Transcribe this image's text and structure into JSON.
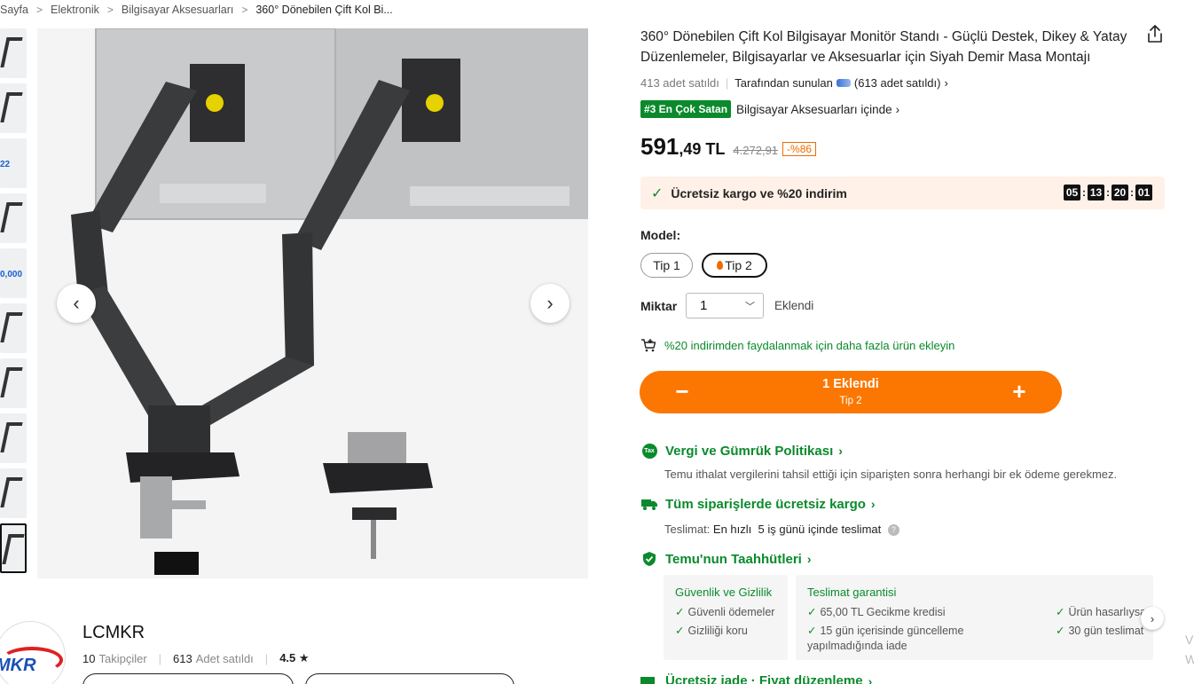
{
  "breadcrumb": {
    "items": [
      "Sayfa",
      "Elektronik",
      "Bilgisayar Aksesuarları",
      "360° Dönebilen Çift Kol Bi..."
    ],
    "separator": ">"
  },
  "gallery": {
    "prev_label": "‹",
    "next_label": "›",
    "thumb_badges": [
      "22",
      "0,000"
    ]
  },
  "seller": {
    "logo_text": "MKR",
    "name": "LCMKR",
    "followers_value": "10",
    "followers_label": "Takipçiler",
    "sold_value": "613",
    "sold_label": "Adet satıldı",
    "rating": "4.5 ★"
  },
  "product": {
    "title": "360° Dönebilen Çift Kol Bilgisayar Monitör Standı - Güçlü Destek, Dikey & Yatay Düzenlemeler, Bilgisayarlar ve Aksesuarlar için Siyah Demir Masa Montajı",
    "sold_count": "413 adet satıldı",
    "offered_by": "Tarafından sunulan",
    "offered_sold": "(613 adet satıldı)",
    "bestseller_tag": "#3 En Çok Satan",
    "bestseller_category": "Bilgisayar Aksesuarları içinde",
    "price_int": "591",
    "price_dec": ",49",
    "currency": "TL",
    "old_price": "4.272,91",
    "discount": "-%86"
  },
  "promo": {
    "text": "Ücretsiz kargo ve %20 indirim",
    "timer": [
      "05",
      "13",
      "20",
      "01"
    ]
  },
  "options": {
    "model_label": "Model:",
    "models": [
      "Tip 1",
      "Tip 2"
    ],
    "selected_model": "Tip 2",
    "qty_label": "Miktar",
    "qty_value": "1",
    "qty_added": "Eklendi"
  },
  "cart_hint": "%20 indirimden faydalanmak için daha fazla ürün ekleyin",
  "add_bar": {
    "minus": "−",
    "plus": "+",
    "main_label": "1 Eklendi",
    "sub_label": "Tip 2"
  },
  "policies": {
    "tax_icon_text": "Tax",
    "tax_title": "Vergi ve Gümrük Politikası",
    "tax_text": "Temu ithalat vergilerini tahsil ettiği için siparişten sonra herhangi bir ek ödeme gerekmez.",
    "shipping_title": "Tüm siparişlerde ücretsiz kargo",
    "delivery_label": "Teslimat:",
    "delivery_value": "En hızlı  5 iş günü içinde teslimat",
    "commit_title": "Temu'nun Taahhütleri",
    "return_title": "Ücretsiz iade · Fiyat düzenleme"
  },
  "commitments": {
    "security_head": "Güvenlik ve Gizlilik",
    "security_items": [
      "Güvenli ödemeler",
      "Gizliliği koru"
    ],
    "delivery_head": "Teslimat garantisi",
    "delivery_items": [
      "65,00 TL Gecikme kredisi",
      "15 gün içerisinde güncelleme",
      "yapılmadığında iade"
    ],
    "extra_items": [
      "Ürün hasarlıysa",
      "30 gün teslimat"
    ]
  },
  "colors": {
    "accent_orange": "#fb7701",
    "success_green": "#0a8a2c",
    "promo_bg": "#fff1e8"
  },
  "icons": [
    "share-icon",
    "chevron-left-icon",
    "chevron-right-icon",
    "check-icon",
    "cart-plus-icon",
    "tax-icon",
    "truck-icon",
    "shield-icon",
    "help-icon",
    "chevron-down-icon"
  ]
}
